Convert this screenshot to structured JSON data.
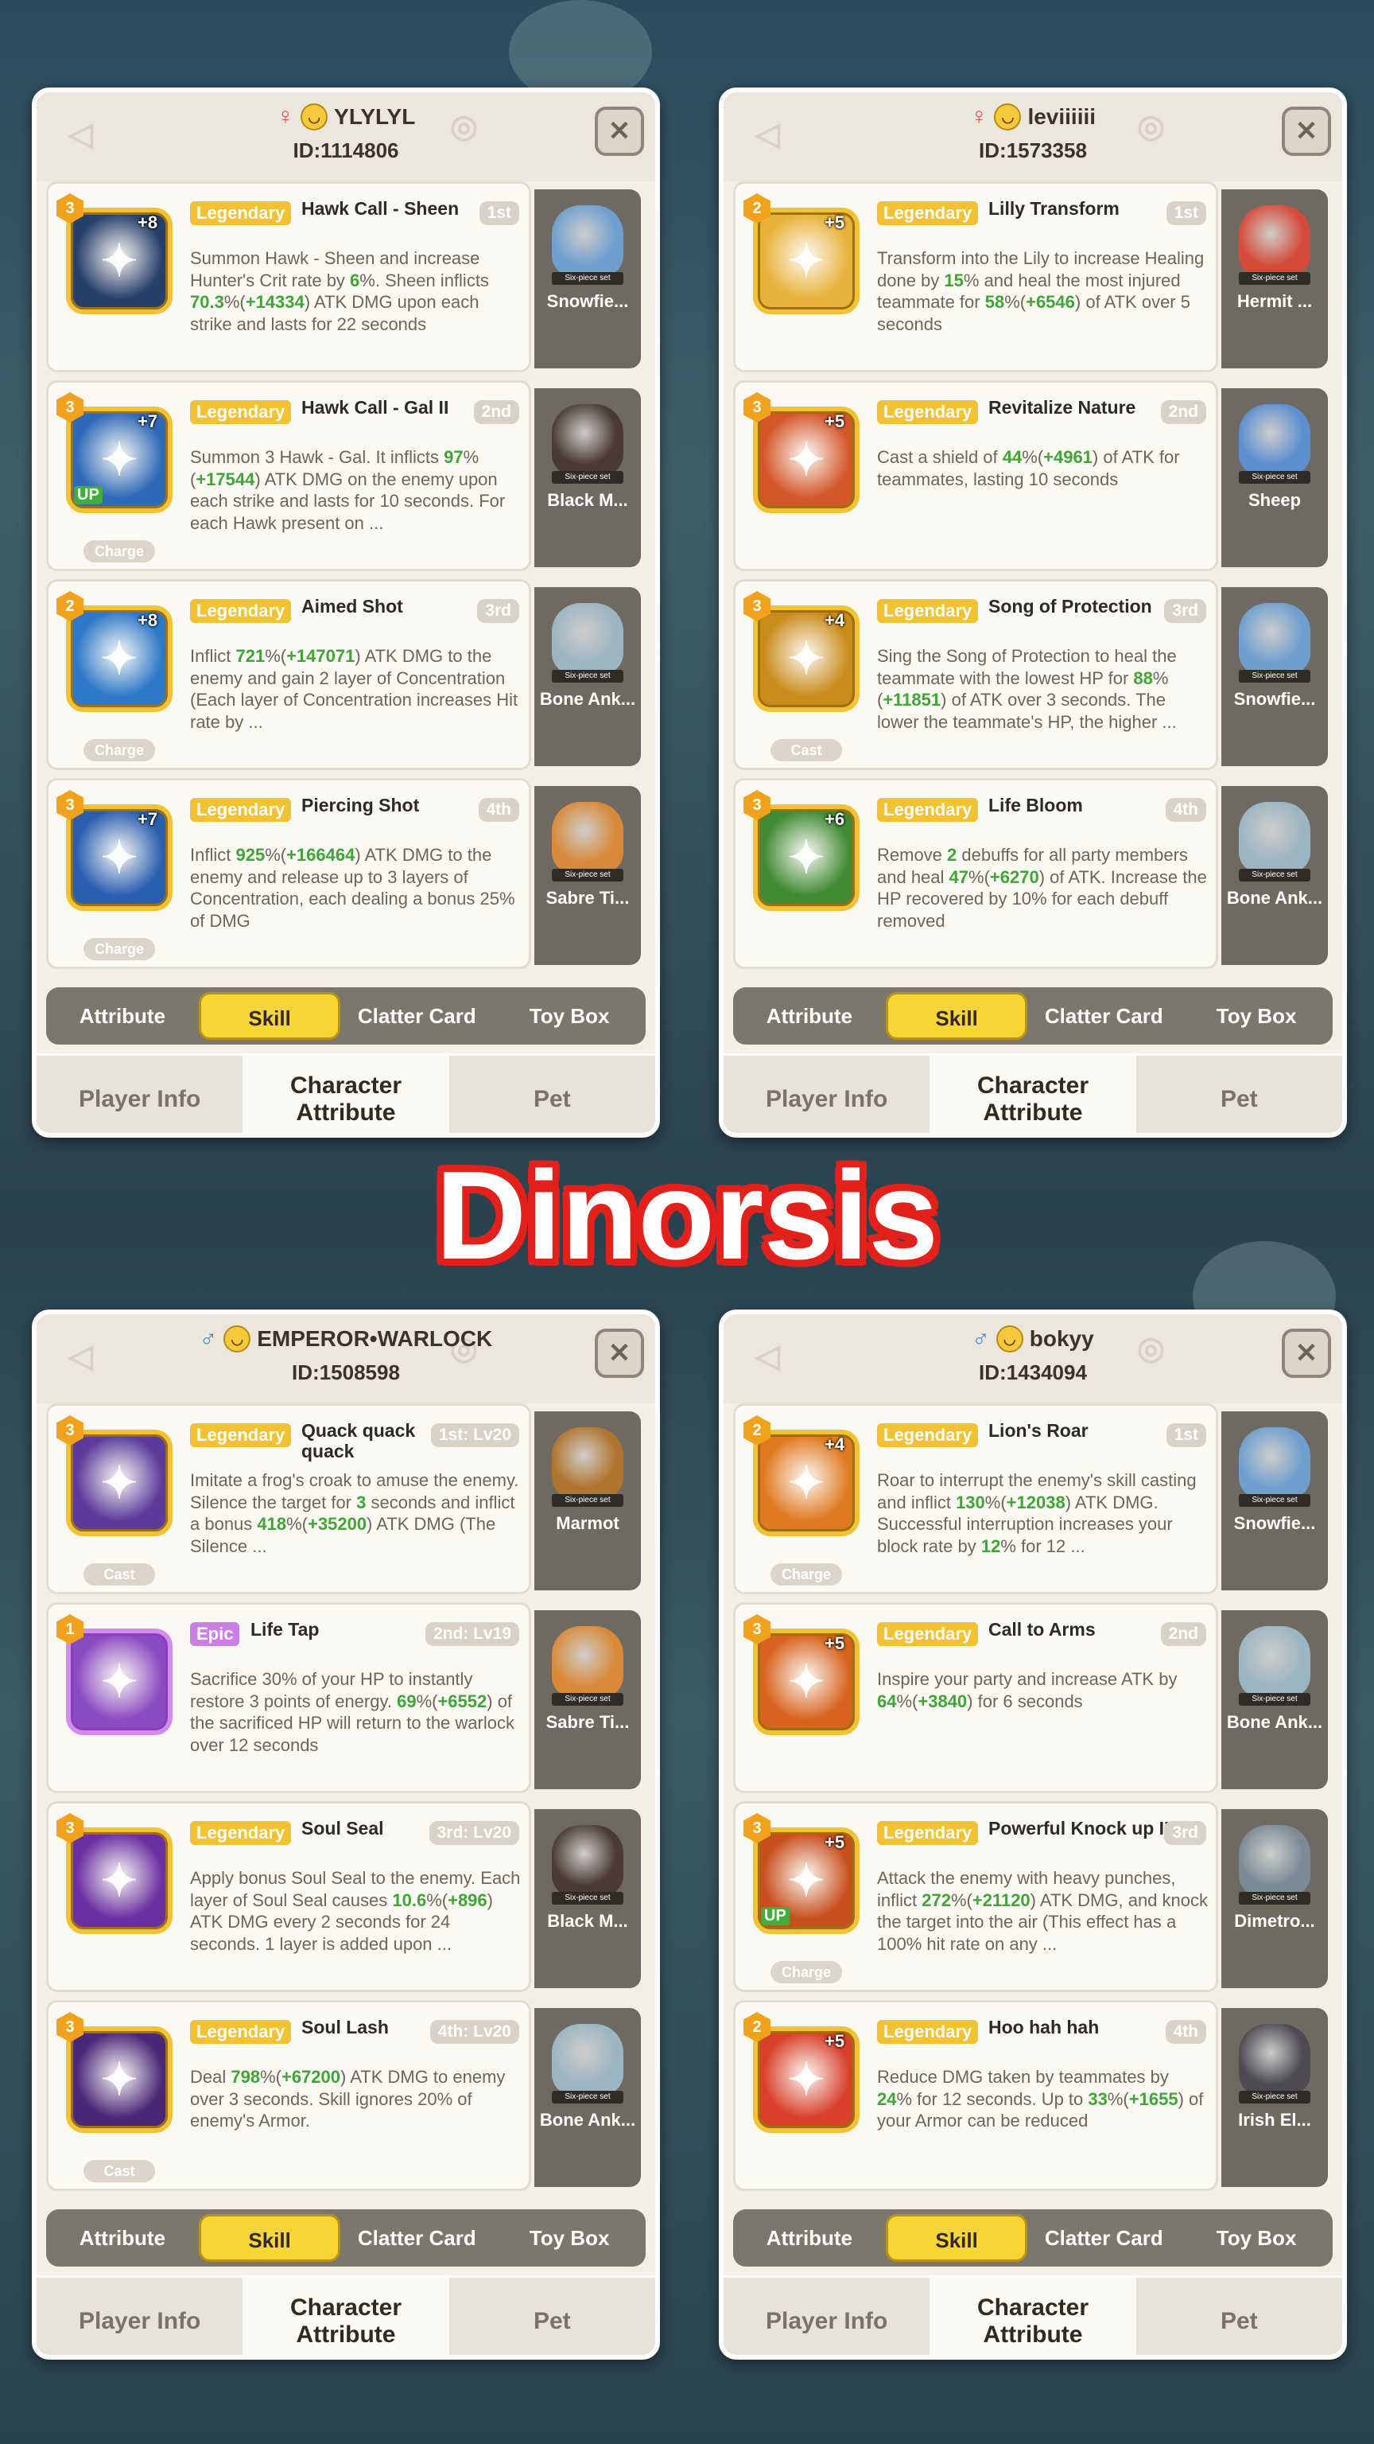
{
  "banner_text": "Dinorsis",
  "tabs": {
    "sub": [
      "Attribute",
      "Skill",
      "Clatter Card",
      "Toy Box"
    ],
    "main": [
      "Player Info",
      "Character\nAttribute",
      "Pet"
    ]
  },
  "pet_set_label": "Six-piece set",
  "panels": [
    {
      "gender": "♀",
      "username": "YLYLYL",
      "id_text": "ID:1114806",
      "skills": [
        {
          "level": "3",
          "plus": "+8",
          "rarity": "Legendary",
          "name": "Hawk Call - Sheen",
          "slot": "1st",
          "chip": "",
          "up": false,
          "icon_color": "#27406a",
          "desc": "Summon Hawk - Sheen and increase Hunter's Crit rate by <g>6</g>%. Sheen inflicts <g>70.3</g>%(<g>+14334</g>) ATK DMG upon each strike and lasts for 22 seconds",
          "pet": "Snowfie...",
          "pet_color": "#6e9fcf"
        },
        {
          "level": "3",
          "plus": "+7",
          "rarity": "Legendary",
          "name": "Hawk Call - Gal II",
          "slot": "2nd",
          "chip": "Charge",
          "up": true,
          "icon_color": "#2f6ab8",
          "desc": "Summon 3 Hawk - Gal. It inflicts <g>97</g>%(<g>+17544</g>) ATK DMG on the enemy upon each strike and lasts for 10 seconds. For each Hawk present on ...",
          "pet": "Black M...",
          "pet_color": "#4a3a36"
        },
        {
          "level": "2",
          "plus": "+8",
          "rarity": "Legendary",
          "name": "Aimed Shot",
          "slot": "3rd",
          "chip": "Charge",
          "up": false,
          "icon_color": "#2d78c8",
          "desc": "Inflict <g>721</g>%(<g>+147071</g>) ATK DMG to the enemy and gain 2 layer of Concentration (Each layer of Concentration increases Hit rate by ...",
          "pet": "Bone Ank...",
          "pet_color": "#9bb5c2"
        },
        {
          "level": "3",
          "plus": "+7",
          "rarity": "Legendary",
          "name": "Piercing Shot",
          "slot": "4th",
          "chip": "Charge",
          "up": false,
          "icon_color": "#2a5fb0",
          "desc": "Inflict <g>925</g>%(<g>+166464</g>) ATK DMG to the enemy and release up to 3 layers of Concentration, each dealing a bonus 25% of DMG",
          "pet": "Sabre Ti...",
          "pet_color": "#d88a3a"
        }
      ]
    },
    {
      "gender": "♀",
      "username": "leviiiiii",
      "id_text": "ID:1573358",
      "skills": [
        {
          "level": "2",
          "plus": "+5",
          "rarity": "Legendary",
          "name": "Lilly Transform",
          "slot": "1st",
          "chip": "",
          "up": false,
          "icon_color": "#e8b23a",
          "desc": "Transform into the Lily to increase Healing done by <g>15</g>% and heal the most injured teammate for <g>58</g>%(<g>+6546</g>) of ATK over 5 seconds",
          "pet": "Hermit ...",
          "pet_color": "#d44b3a"
        },
        {
          "level": "3",
          "plus": "+5",
          "rarity": "Legendary",
          "name": "Revitalize Nature",
          "slot": "2nd",
          "chip": "",
          "up": false,
          "icon_color": "#d4572a",
          "desc": "Cast a shield of <g>44</g>%(<g>+4961</g>) of ATK for teammates, lasting 10 seconds",
          "pet": "Sheep",
          "pet_color": "#5c8fd0"
        },
        {
          "level": "3",
          "plus": "+4",
          "rarity": "Legendary",
          "name": "Song of Protection",
          "slot": "3rd",
          "chip": "Cast",
          "up": false,
          "icon_color": "#c98b1a",
          "desc": "Sing the Song of Protection to heal the teammate with the lowest HP for <g>88</g>%(<g>+11851</g>) of ATK over 3 seconds. The lower the teammate's HP, the higher ...",
          "pet": "Snowfie...",
          "pet_color": "#6e9fcf"
        },
        {
          "level": "3",
          "plus": "+6",
          "rarity": "Legendary",
          "name": "Life Bloom",
          "slot": "4th",
          "chip": "",
          "up": false,
          "icon_color": "#3f8a32",
          "desc": "Remove <g>2</g> debuffs for all party members and heal <g>47</g>%(<g>+6270</g>) of ATK. Increase the HP recovered by 10% for each debuff removed",
          "pet": "Bone Ank...",
          "pet_color": "#9bb5c2"
        }
      ]
    },
    {
      "gender": "♂",
      "username": "EMPEROR•WARLOCK",
      "id_text": "ID:1508598",
      "skills": [
        {
          "level": "3",
          "plus": "",
          "rarity": "Legendary",
          "name": "Quack quack quack",
          "slot": "1st: Lv20",
          "chip": "Cast",
          "up": false,
          "icon_color": "#5a3a9a",
          "desc": "Imitate a frog's croak to amuse the enemy. Silence the target for <g>3</g> seconds and inflict a bonus <g>418</g>%(<g>+35200</g>) ATK DMG (The Silence ...",
          "pet": "Marmot",
          "pet_color": "#b0742e"
        },
        {
          "level": "1",
          "plus": "",
          "rarity": "Epic",
          "name": "Life Tap",
          "slot": "2nd: Lv19",
          "chip": "",
          "up": false,
          "icon_color": "#8a4ac0",
          "desc": "Sacrifice 30% of your HP to instantly restore 3 points of energy. <g>69</g>%(<g>+6552</g>) of the sacrificed HP will return to the warlock over 12 seconds",
          "pet": "Sabre Ti...",
          "pet_color": "#d88a3a"
        },
        {
          "level": "3",
          "plus": "",
          "rarity": "Legendary",
          "name": "Soul Seal",
          "slot": "3rd: Lv20",
          "chip": "",
          "up": false,
          "icon_color": "#6a2fa0",
          "desc": "Apply bonus Soul Seal to the enemy. Each layer of Soul Seal causes <g>10.6</g>%(<g>+896</g>) ATK DMG every 2 seconds for 24 seconds. 1 layer is added upon ...",
          "pet": "Black M...",
          "pet_color": "#4a3a36"
        },
        {
          "level": "3",
          "plus": "",
          "rarity": "Legendary",
          "name": "Soul Lash",
          "slot": "4th: Lv20",
          "chip": "Cast",
          "up": false,
          "icon_color": "#4a2878",
          "desc": "Deal <g>798</g>%(<g>+67200</g>) ATK DMG to enemy over 3 seconds. Skill ignores 20% of enemy's Armor.",
          "pet": "Bone Ank...",
          "pet_color": "#9bb5c2"
        }
      ]
    },
    {
      "gender": "♂",
      "username": "bokyy",
      "id_text": "ID:1434094",
      "skills": [
        {
          "level": "2",
          "plus": "+4",
          "rarity": "Legendary",
          "name": "Lion's Roar",
          "slot": "1st",
          "chip": "Charge",
          "up": false,
          "icon_color": "#e07a22",
          "desc": "Roar to interrupt the enemy's skill casting and inflict <g>130</g>%(<g>+12038</g>) ATK DMG. Successful interruption increases your block rate by <g>12</g>% for 12 ...",
          "pet": "Snowfie...",
          "pet_color": "#6e9fcf"
        },
        {
          "level": "3",
          "plus": "+5",
          "rarity": "Legendary",
          "name": "Call to Arms",
          "slot": "2nd",
          "chip": "",
          "up": false,
          "icon_color": "#d8631e",
          "desc": "Inspire your party and increase ATK by <g>64</g>%(<g>+3840</g>) for 6 seconds",
          "pet": "Bone Ank...",
          "pet_color": "#9bb5c2"
        },
        {
          "level": "3",
          "plus": "+5",
          "rarity": "Legendary",
          "name": "Powerful Knock up II",
          "slot": "3rd",
          "chip": "Charge",
          "up": true,
          "icon_color": "#c8501e",
          "desc": "Attack the enemy with heavy punches, inflict <g>272</g>%(<g>+21120</g>) ATK DMG, and knock the target into the air (This effect has a 100% hit rate on any ...",
          "pet": "Dimetro...",
          "pet_color": "#7a8b96"
        },
        {
          "level": "2",
          "plus": "+5",
          "rarity": "Legendary",
          "name": "Hoo hah hah",
          "slot": "4th",
          "chip": "",
          "up": false,
          "icon_color": "#d8402a",
          "desc": "Reduce DMG taken by teammates by <g>24</g>% for 12 seconds. Up to <g>33</g>%(<g>+1655</g>) of your Armor can be reduced",
          "pet": "Irish El...",
          "pet_color": "#4d4a52"
        }
      ]
    }
  ]
}
